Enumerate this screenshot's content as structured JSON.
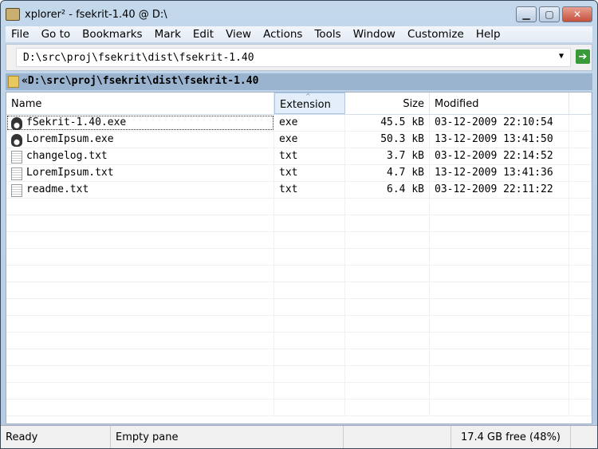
{
  "window": {
    "title": "xplorer² - fsekrit-1.40 @ D:\\",
    "minimize": "▁",
    "maximize": "▢",
    "close": "✕"
  },
  "menu": [
    "File",
    "Go to",
    "Bookmarks",
    "Mark",
    "Edit",
    "View",
    "Actions",
    "Tools",
    "Window",
    "Customize",
    "Help"
  ],
  "address": {
    "value": "D:\\src\\proj\\fsekrit\\dist\\fsekrit-1.40",
    "dropdown": "▼",
    "go": "➔"
  },
  "pathbar": "«D:\\src\\proj\\fsekrit\\dist\\fsekrit-1.40",
  "columns": {
    "name": "Name",
    "ext": "Extension",
    "size": "Size",
    "modified": "Modified",
    "sort_indicator": "^"
  },
  "files": [
    {
      "name": "fSekrit-1.40.exe",
      "ext": "exe",
      "size": "45.5 kB",
      "modified": "03-12-2009 22:10:54",
      "icon": "exe"
    },
    {
      "name": "LoremIpsum.exe",
      "ext": "exe",
      "size": "50.3 kB",
      "modified": "13-12-2009 13:41:50",
      "icon": "exe"
    },
    {
      "name": "changelog.txt",
      "ext": "txt",
      "size": "3.7 kB",
      "modified": "03-12-2009 22:14:52",
      "icon": "txt"
    },
    {
      "name": "LoremIpsum.txt",
      "ext": "txt",
      "size": "4.7 kB",
      "modified": "13-12-2009 13:41:36",
      "icon": "txt"
    },
    {
      "name": "readme.txt",
      "ext": "txt",
      "size": "6.4 kB",
      "modified": "03-12-2009 22:11:22",
      "icon": "txt"
    }
  ],
  "status": {
    "state": "Ready",
    "pane": "Empty pane",
    "free": "17.4 GB free (48%)"
  }
}
